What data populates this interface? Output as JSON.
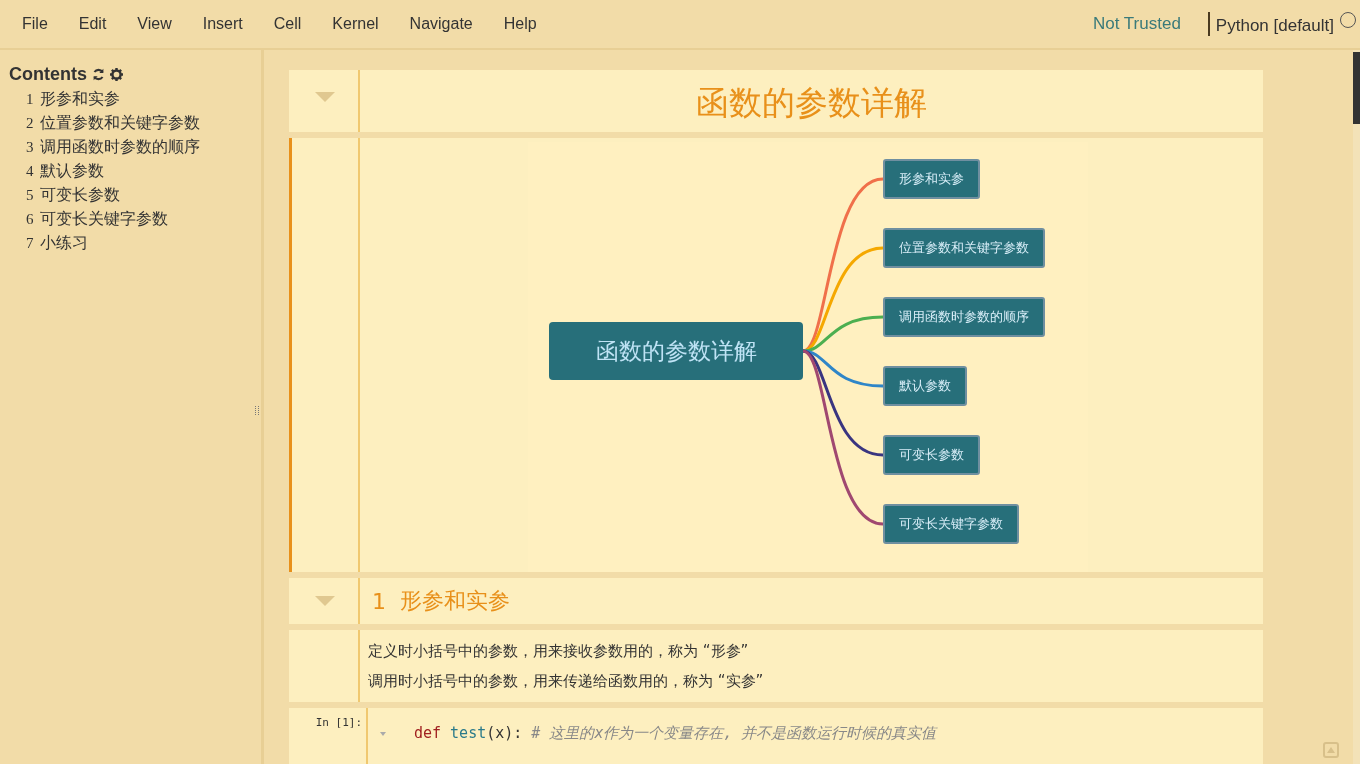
{
  "menu": [
    "File",
    "Edit",
    "View",
    "Insert",
    "Cell",
    "Kernel",
    "Navigate",
    "Help"
  ],
  "trust": "Not Trusted",
  "kernel": {
    "name": "Python [default]",
    "busy": false
  },
  "toc": {
    "title": "Contents",
    "items": [
      {
        "number": "1",
        "label": "形参和实参"
      },
      {
        "number": "2",
        "label": "位置参数和关键字参数"
      },
      {
        "number": "3",
        "label": "调用函数时参数的顺序"
      },
      {
        "number": "4",
        "label": "默认参数"
      },
      {
        "number": "5",
        "label": "可变长参数"
      },
      {
        "number": "6",
        "label": "可变长关键字参数"
      },
      {
        "number": "7",
        "label": "小练习"
      }
    ]
  },
  "cells": [
    {
      "kind": "title",
      "text": "函数的参数详解",
      "selected": false
    },
    {
      "kind": "mindmap",
      "selected": true,
      "root": "函数的参数详解",
      "branches": [
        {
          "label": "形参和实参",
          "color": "#f0704a"
        },
        {
          "label": "位置参数和关键字参数",
          "color": "#f5a800"
        },
        {
          "label": "调用函数时参数的顺序",
          "color": "#4caf50"
        },
        {
          "label": "默认参数",
          "color": "#2f86c8"
        },
        {
          "label": "可变长参数",
          "color": "#3a3580"
        },
        {
          "label": "可变长关键字参数",
          "color": "#a04870"
        }
      ]
    },
    {
      "kind": "heading",
      "number": "1",
      "text": "形参和实参",
      "selected": false
    },
    {
      "kind": "text",
      "selected": false,
      "lines": [
        "定义时小括号中的参数，用来接收参数用的，称为 “形参”",
        "调用时小括号中的参数，用来传递给函数用的，称为 “实参”"
      ]
    },
    {
      "kind": "code",
      "selected": false,
      "prompt": "In [1]:",
      "keyword": "def",
      "name": "test",
      "args": "(x):",
      "comment": "# 这里的x作为一个变量存在, 并不是函数运行时候的真实值"
    }
  ]
}
